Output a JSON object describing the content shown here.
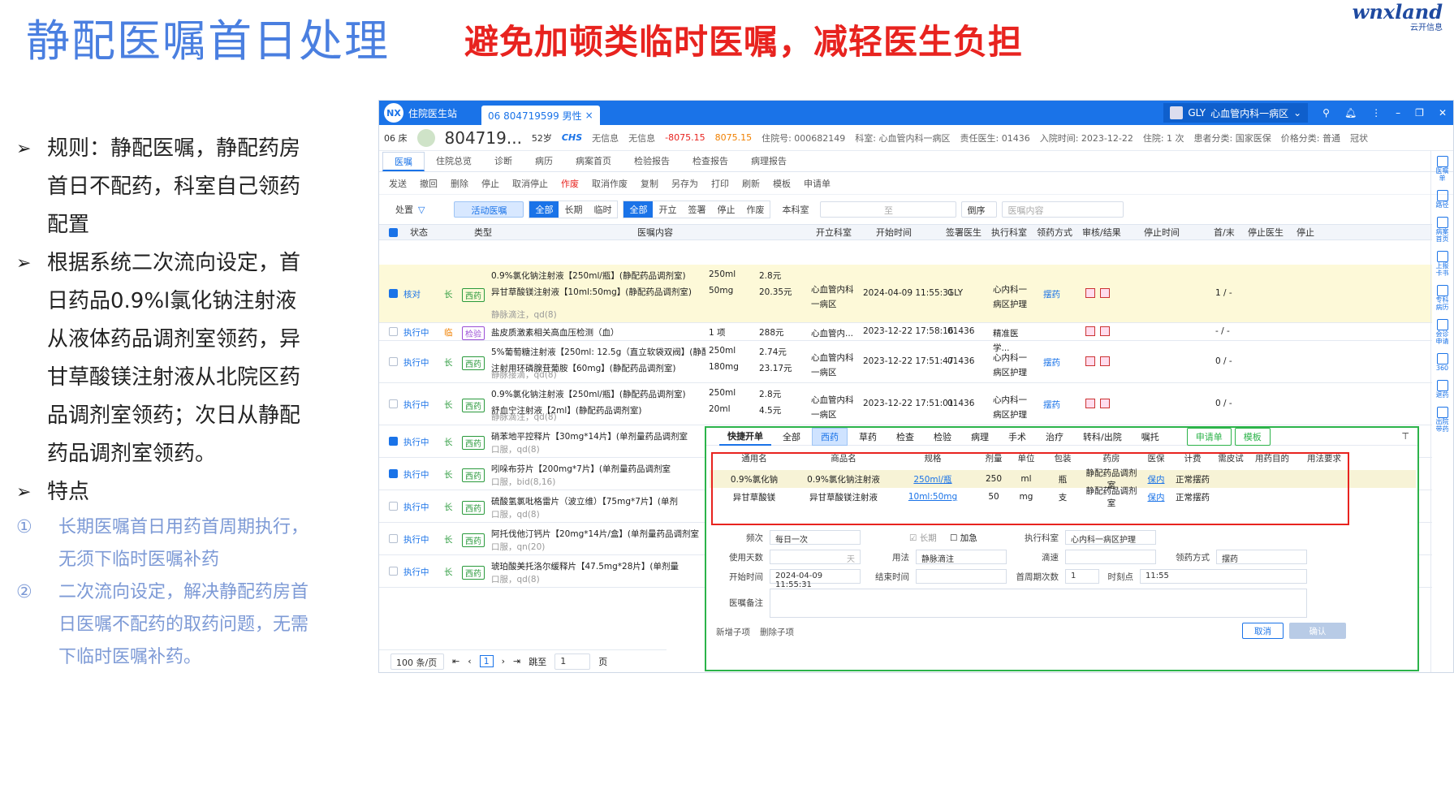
{
  "slide": {
    "title": "静配医嘱首日处理",
    "subtitle": "避免加顿类临时医嘱，减轻医生负担",
    "logo": "wnxland",
    "logo_sub": "云开信息"
  },
  "bullets": [
    {
      "text": "规则：静配医嘱，静配药房首日不配药，科室自己领药配置"
    },
    {
      "text": "根据系统二次流向设定，首日药品0.9%l氯化钠注射液从液体药品调剂室领药，异甘草酸镁注射液从北院区药品调剂室领药；次日从静配药品调剂室领药。"
    },
    {
      "text": "特点"
    }
  ],
  "subpoints": [
    {
      "num": "①",
      "text": "长期医嘱首日用药首周期执行，无须下临时医嘱补药"
    },
    {
      "num": "②",
      "text": "二次流向设定，解决静配药房首日医嘱不配药的取药问题，无需下临时医嘱补药。"
    }
  ],
  "app": {
    "logo": "NX",
    "name": "住院医生站",
    "tab": "06 804719599 男性",
    "user": "GLY",
    "dept": "心血管内科一病区",
    "patient": {
      "bed": "06 床",
      "id": "804719...",
      "age": "52岁",
      "ins": "CHS",
      "info1": "无信息",
      "info2": "无信息",
      "bal1": "-8075.15",
      "bal2": "8075.15",
      "admno": "住院号: 000682149",
      "ward": "科室: 心血管内科一病区",
      "doctor": "责任医生: 01436",
      "admdate": "入院时间: 2023-12-22",
      "stay": "住院: 1 次",
      "cat": "患者分类: 国家医保",
      "price": "价格分类: 普通",
      "extra": "冠状"
    },
    "navtabs": [
      "医嘱",
      "住院总览",
      "诊断",
      "病历",
      "病案首页",
      "检验报告",
      "检查报告",
      "病理报告"
    ],
    "toolbar": [
      "发送",
      "撤回",
      "删除",
      "停止",
      "取消停止",
      "作废",
      "取消作废",
      "复制",
      "另存为",
      "打印",
      "刷新",
      "模板",
      "申请单"
    ],
    "filter": {
      "label": "处置",
      "active": "活动医嘱",
      "seg1": [
        "全部",
        "长期",
        "临时"
      ],
      "seg2": [
        "全部",
        "开立",
        "签署",
        "停止",
        "作废"
      ],
      "dept": "本科室",
      "to": "至",
      "order": "倒序",
      "search": "医嘱内容"
    },
    "columns": [
      "状态",
      "类型",
      "医嘱内容",
      "开立科室",
      "开始时间",
      "签署医生",
      "执行科室",
      "领药方式",
      "审核/结果",
      "停止时间",
      "首/末",
      "停止医生",
      "停止"
    ],
    "rows": [
      {
        "status": "核对",
        "type": "长",
        "tag": "西药",
        "lines": [
          [
            "0.9%氯化钠注射液【250ml/瓶】(静配药品调剂室)",
            "250ml",
            "2.8元"
          ],
          [
            "异甘草酸镁注射液【10ml:50mg】(静配药品调剂室)",
            "50mg",
            "20.35元"
          ]
        ],
        "usage": "静脉滴注，qd(8)",
        "dept": "心血管内科一病区",
        "start": "2024-04-09 11:55:31",
        "doc": "GLY",
        "exec": "心内科一病区护理",
        "pick": "摆药",
        "fl": "1 / -"
      },
      {
        "status": "执行中",
        "type": "临",
        "tag": "检验",
        "lines": [
          [
            "盐皮质激素相关高血压检测（血）",
            "1 项",
            "288元"
          ]
        ],
        "usage": "",
        "dept": "心血管内...",
        "start": "2023-12-22 17:58:16",
        "doc": "01436",
        "exec": "精准医学...",
        "pick": "",
        "fl": "- / -"
      },
      {
        "status": "执行中",
        "type": "长",
        "tag": "西药",
        "lines": [
          [
            "5%葡萄糖注射液【250ml: 12.5g（直立软袋双阀】(静配药品...",
            "250ml",
            "2.74元"
          ],
          [
            "注射用环磷腺苷葡胺【60mg】(静配药品调剂室)",
            "180mg",
            "23.17元"
          ]
        ],
        "usage": "静脉接滴，qd(8)",
        "dept": "心血管内科一病区",
        "start": "2023-12-22 17:51:47",
        "doc": "01436",
        "exec": "心内科一病区护理",
        "pick": "摆药",
        "fl": "0 / -"
      },
      {
        "status": "执行中",
        "type": "长",
        "tag": "西药",
        "lines": [
          [
            "0.9%氯化钠注射液【250ml/瓶】(静配药品调剂室)",
            "250ml",
            "2.8元"
          ],
          [
            "舒血宁注射液【2ml】(静配药品调剂室)",
            "20ml",
            "4.5元"
          ]
        ],
        "usage": "静脉滴注，qd(8)",
        "dept": "心血管内科一病区",
        "start": "2023-12-22 17:51:01",
        "doc": "01436",
        "exec": "心内科一病区护理",
        "pick": "摆药",
        "fl": "0 / -"
      },
      {
        "status": "执行中",
        "type": "长",
        "tag": "西药",
        "lines": [
          [
            "硝苯地平控释片【30mg*14片】(单剂量药品调剂室",
            "",
            ""
          ]
        ],
        "usage": "口服，qd(8)",
        "checked": true
      },
      {
        "status": "执行中",
        "type": "长",
        "tag": "西药",
        "lines": [
          [
            "吲哚布芬片【200mg*7片】(单剂量药品调剂室",
            "",
            ""
          ]
        ],
        "usage": "口服，bid(8,16)",
        "checked": true
      },
      {
        "status": "执行中",
        "type": "长",
        "tag": "西药",
        "lines": [
          [
            "硫酸氢氯吡格雷片（波立维）【75mg*7片】(单剂",
            "",
            ""
          ]
        ],
        "usage": "口服，qd(8)"
      },
      {
        "status": "执行中",
        "type": "长",
        "tag": "西药",
        "lines": [
          [
            "阿托伐他汀钙片【20mg*14片/盒】(单剂量药品调剂室",
            "",
            ""
          ]
        ],
        "usage": "口服，qn(20)"
      },
      {
        "status": "执行中",
        "type": "长",
        "tag": "西药",
        "lines": [
          [
            "琥珀酸美托洛尔缓释片【47.5mg*28片】(单剂量",
            "",
            ""
          ]
        ],
        "usage": "口服，qd(8)"
      }
    ],
    "pager": {
      "size": "100 条/页",
      "page": "1",
      "goto": "跳至",
      "goto_val": "1",
      "unit": "页"
    },
    "sidebar": [
      "医嘱单",
      "路径",
      "病案首页",
      "上报卡书",
      "专科病历",
      "会诊申请",
      "360",
      "退药",
      "出院带药"
    ],
    "panel": {
      "tabs": [
        "快捷开单",
        "全部",
        "西药",
        "草药",
        "检查",
        "检验",
        "病理",
        "手术",
        "治疗",
        "转科/出院",
        "嘱托"
      ],
      "btn1": "申请单",
      "btn2": "模板",
      "headers": [
        "通用名",
        "商品名",
        "规格",
        "剂量",
        "单位",
        "包装",
        "药房",
        "医保",
        "计费",
        "需皮试",
        "用药目的",
        "用法要求"
      ],
      "items": [
        [
          "0.9%氯化钠",
          "0.9%氯化钠注射液",
          "250ml/瓶",
          "250",
          "ml",
          "瓶",
          "静配药品调剂室",
          "保内",
          "正常摆药"
        ],
        [
          "异甘草酸镁",
          "异甘草酸镁注射液",
          "10ml:50mg",
          "50",
          "mg",
          "支",
          "静配药品调剂室",
          "保内",
          "正常摆药"
        ]
      ],
      "form": {
        "freq_l": "频次",
        "freq": "每日一次",
        "long": "长期",
        "urgent": "加急",
        "exec_l": "执行科室",
        "exec": "心内科一病区护理",
        "days_l": "使用天数",
        "days_unit": "天",
        "usage_l": "用法",
        "usage": "静脉滴注",
        "drip_l": "滴速",
        "pick_l": "领药方式",
        "pick": "摆药",
        "start_l": "开始时间",
        "start": "2024-04-09 11:55:31",
        "end_l": "结束时间",
        "first_l": "首周期次数",
        "first": "1",
        "time_l": "时刻点",
        "time": "11:55",
        "note_l": "医嘱备注",
        "add": "新增子项",
        "del": "删除子项",
        "cancel": "取消",
        "ok": "确认"
      }
    }
  }
}
